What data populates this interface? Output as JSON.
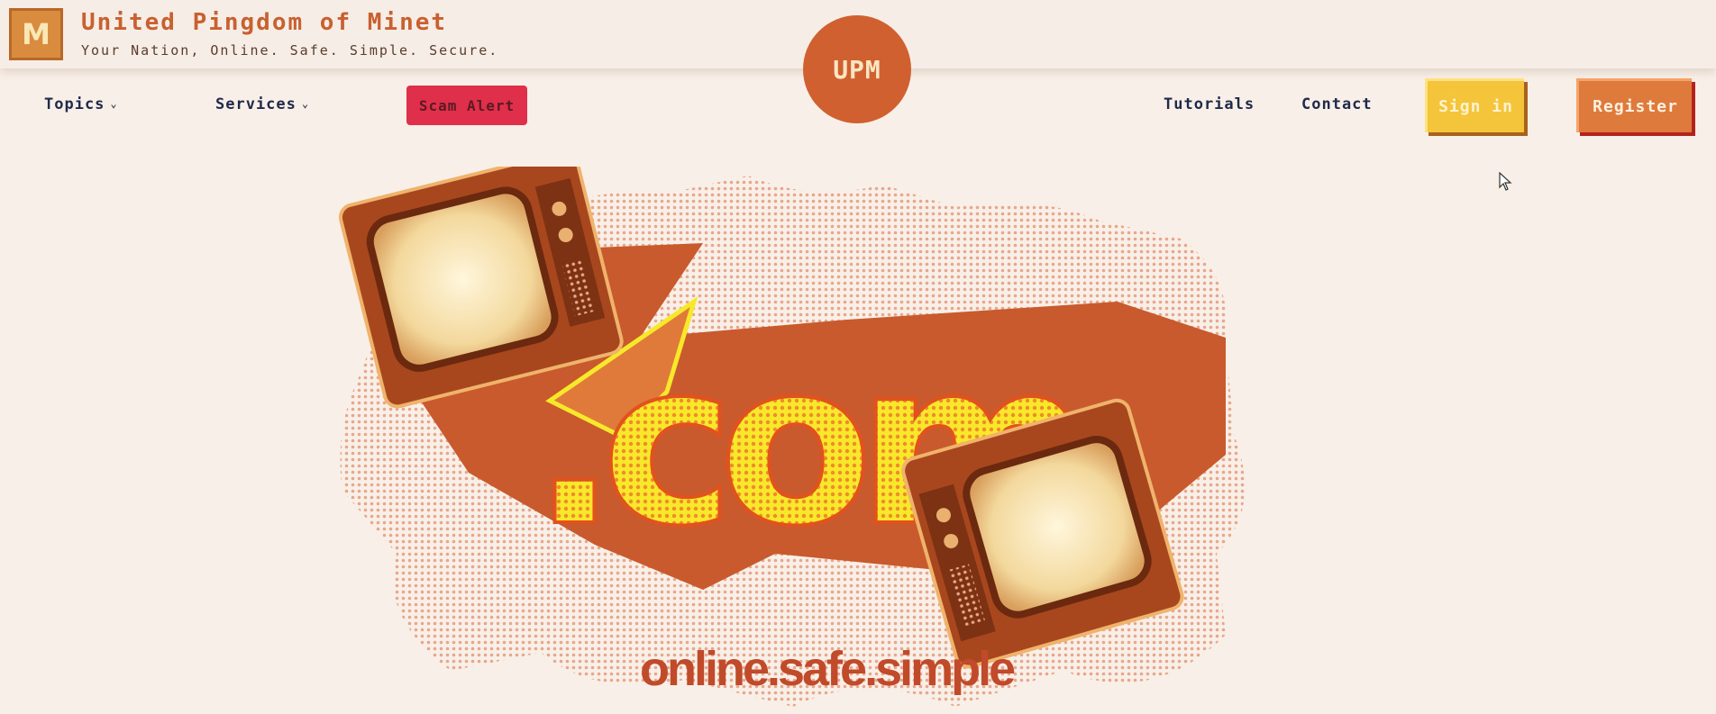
{
  "header": {
    "logo_letter": "M",
    "site_title": "United Pingdom of Minet",
    "tagline": "Your Nation, Online. Safe. Simple. Secure.",
    "badge": "UPM"
  },
  "nav": {
    "topics": "Topics",
    "services": "Services",
    "scam_alert": "Scam Alert",
    "tutorials": "Tutorials",
    "contact": "Contact",
    "sign_in": "Sign in",
    "register": "Register"
  },
  "hero": {
    "big_text": ".com",
    "tagline": "online.safe.simple"
  },
  "colors": {
    "background": "#f8f0e8",
    "brand_orange": "#d0602f",
    "scam_red": "#df2f4a",
    "signin_yellow": "#f4c43a",
    "register_orange": "#dd7a3c",
    "nav_text": "#1f2a4a"
  },
  "icons": [
    "chevron-down-icon",
    "tv-icon",
    "cursor-icon"
  ]
}
